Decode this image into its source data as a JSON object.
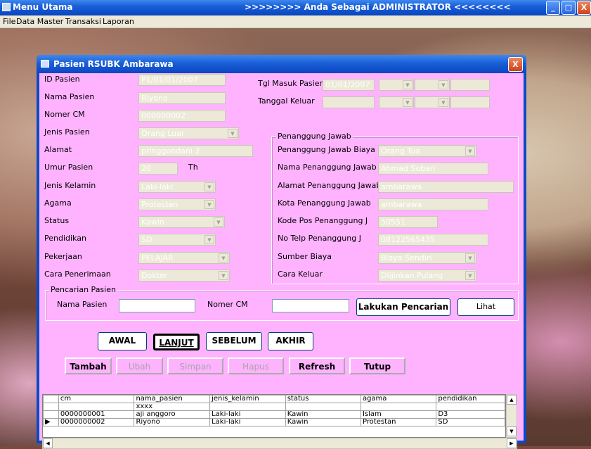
{
  "window": {
    "title": "Menu Utama",
    "role_banner": ">>>>>>>> Anda Sebagai ADMINISTRATOR <<<<<<<<",
    "min": "_",
    "max": "□",
    "close": "X"
  },
  "menu": [
    "File",
    "Data Master",
    "Transaksi",
    "Laporan"
  ],
  "dialog": {
    "title": "Pasien RSUBK Ambarawa",
    "close": "X"
  },
  "form": {
    "id_pasien": {
      "label": "ID Pasien",
      "value": "P1/01/01/2007"
    },
    "nama_pasien": {
      "label": "Nama Pasien",
      "value": "Riyono"
    },
    "nomer_cm": {
      "label": "Nomer CM",
      "value": "000000002"
    },
    "jenis_pasien": {
      "label": "Jenis Pasien",
      "value": "Orang Luar"
    },
    "alamat": {
      "label": "Alamat",
      "value": "pringgondani 2"
    },
    "umur": {
      "label": "Umur Pasien",
      "value": "20",
      "unit": "Th"
    },
    "jenis_kelamin": {
      "label": "Jenis Kelamin",
      "value": "Laki-laki"
    },
    "agama": {
      "label": "Agama",
      "value": "Protestan"
    },
    "status": {
      "label": "Status",
      "value": "Kawin"
    },
    "pendidikan": {
      "label": "Pendidikan",
      "value": "SD"
    },
    "pekerjaan": {
      "label": "Pekerjaan",
      "value": "PELAJAR"
    },
    "cara_penerimaan": {
      "label": "Cara Penerimaan",
      "value": "Dokter"
    },
    "tgl_masuk": {
      "label": "Tgl Masuk Pasien:",
      "value": "01/01/2007"
    },
    "tgl_keluar": {
      "label": "Tanggal Keluar",
      "value": ""
    }
  },
  "penanggung": {
    "legend": "Penanggung Jawab",
    "biaya": {
      "label": "Penanggung Jawab Biaya",
      "value": "Orang Tua"
    },
    "nama": {
      "label": "Nama Penanggung Jawab",
      "value": "Ahmad Sobari"
    },
    "alamat": {
      "label": "Alamat Penanggung Jawab",
      "value": "ambarawa"
    },
    "kota": {
      "label": "Kota Penanggung Jawab",
      "value": "ambarawa"
    },
    "kodepos": {
      "label": "Kode Pos Penanggung J",
      "value": "50551"
    },
    "telp": {
      "label": "No Telp Penanggung  J",
      "value": "08122565435"
    },
    "sumber": {
      "label": "Sumber Biaya",
      "value": "Biaya Sendiri"
    },
    "cara_keluar": {
      "label": "Cara Keluar",
      "value": "Diijinkan Pulang"
    }
  },
  "pencarian": {
    "legend": "Pencarian Pasien",
    "nama_label": "Nama Pasien",
    "cm_label": "Nomer CM",
    "nama_value": "",
    "cm_value": "",
    "search_btn": "Lakukan Pencarian",
    "lihat_btn": "Lihat"
  },
  "nav": {
    "awal": "AWAL",
    "lanjut": "LANJUT",
    "sebelum": "SEBELUM",
    "akhir": "AKHIR"
  },
  "actions": {
    "tambah": "Tambah",
    "ubah": "Ubah",
    "simpan": "Simpan",
    "hapus": "Hapus",
    "refresh": "Refresh",
    "tutup": "Tutup"
  },
  "grid": {
    "columns": [
      "cm",
      "nama_pasien",
      "jenis_kelamin",
      "status",
      "agama",
      "pendidikan"
    ],
    "rows": [
      [
        "",
        "xxxx",
        "",
        "",
        "",
        ""
      ],
      [
        "0000000001",
        "aji anggoro",
        "Laki-laki",
        "Kawin",
        "Islam",
        "D3"
      ],
      [
        "0000000002",
        "Riyono",
        "Laki-laki",
        "Kawin",
        "Protestan",
        "SD"
      ]
    ],
    "current_marker": "▶"
  }
}
